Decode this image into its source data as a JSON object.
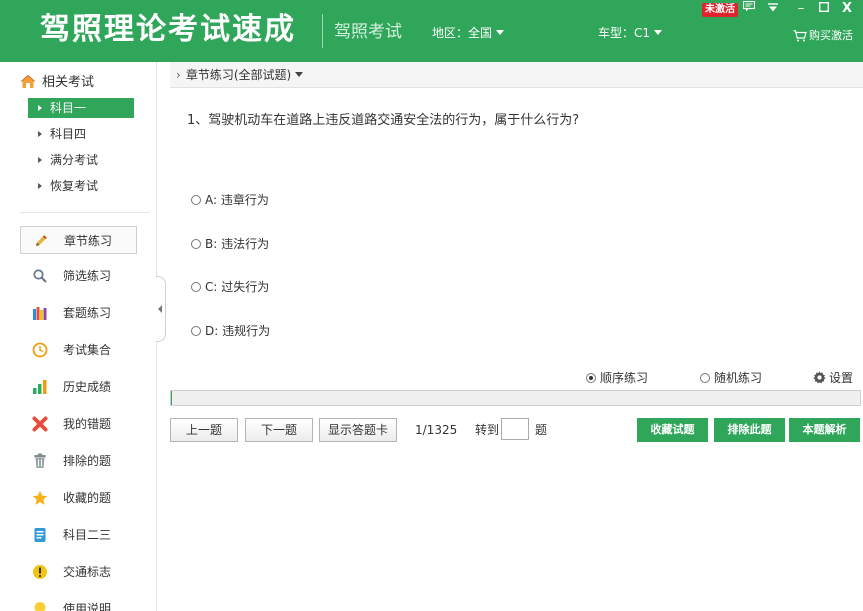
{
  "header": {
    "app_title": "驾照理论考试速成",
    "subtitle": "驾照考试",
    "region": "地区：全国",
    "car_type": "车型：C1",
    "badge": "未激活",
    "buy_label": "购买激活",
    "minimize": "–",
    "close": "X"
  },
  "sidebar": {
    "related_label": "相关考试",
    "subjects": [
      {
        "label": "科目一"
      },
      {
        "label": "科目四"
      },
      {
        "label": "满分考试"
      },
      {
        "label": "恢复考试"
      }
    ],
    "items": [
      {
        "label": "章节练习",
        "icon": "pencil-icon"
      },
      {
        "label": "筛选练习",
        "icon": "search-icon"
      },
      {
        "label": "套题练习",
        "icon": "books-icon"
      },
      {
        "label": "考试集合",
        "icon": "clock-icon"
      },
      {
        "label": "历史成绩",
        "icon": "bar-chart-icon"
      },
      {
        "label": "我的错题",
        "icon": "cross-icon"
      },
      {
        "label": "排除的题",
        "icon": "trash-icon"
      },
      {
        "label": "收藏的题",
        "icon": "star-icon"
      },
      {
        "label": "科目二三",
        "icon": "document-icon"
      },
      {
        "label": "交通标志",
        "icon": "warning-icon"
      },
      {
        "label": "使用说明",
        "icon": "bulb-icon"
      }
    ]
  },
  "main": {
    "breadcrumb": "章节练习(全部试题)",
    "question": "1、驾驶机动车在道路上违反道路交通安全法的行为，属于什么行为?",
    "options": [
      {
        "label": "A: 违章行为"
      },
      {
        "label": "B: 违法行为"
      },
      {
        "label": "C: 过失行为"
      },
      {
        "label": "D: 违规行为"
      }
    ],
    "mode_sequential": "顺序练习",
    "mode_random": "随机练习",
    "settings_label": "设置",
    "progress_fraction": 0.001,
    "buttons": {
      "prev": "上一题",
      "next": "下一题",
      "show_card": "显示答题卡"
    },
    "page_info": "1/1325",
    "goto_label": "转到",
    "goto_value": "",
    "goto_suffix": "题",
    "action_buttons": {
      "favorite": "收藏试题",
      "exclude": "排除此题",
      "explain": "本题解析"
    }
  },
  "colors": {
    "brand_green": "#2fa65a",
    "badge_red": "#e0242e"
  }
}
